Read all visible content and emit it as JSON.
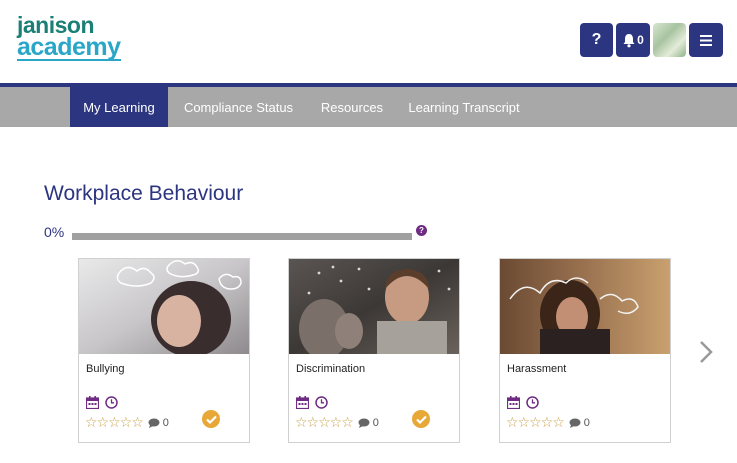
{
  "header": {
    "logo_line1": "janison",
    "logo_line2": "academy",
    "help_label": "?",
    "notification_count": "0"
  },
  "nav": {
    "items": [
      {
        "label": "My Learning",
        "active": true
      },
      {
        "label": "Compliance Status",
        "active": false
      },
      {
        "label": "Resources",
        "active": false
      },
      {
        "label": "Learning Transcript",
        "active": false
      }
    ]
  },
  "main": {
    "title": "Workplace Behaviour",
    "progress_label": "0%",
    "progress_value": 0,
    "progress_help": "?",
    "cards": [
      {
        "title": "Bullying",
        "stars": "☆☆☆☆☆",
        "comments": "0",
        "completed": true
      },
      {
        "title": "Discrimination",
        "stars": "☆☆☆☆☆",
        "comments": "0",
        "completed": true
      },
      {
        "title": "Harassment",
        "stars": "☆☆☆☆☆",
        "comments": "0",
        "completed": false
      }
    ]
  },
  "colors": {
    "brand_navy": "#2c3580",
    "nav_gray": "#a8a8a8",
    "logo_teal": "#1c7f76",
    "logo_blue": "#2aa6c8",
    "accent_purple": "#6e2c83",
    "star_gold": "#c8a04a",
    "complete_orange": "#e8a838"
  },
  "icons": [
    "help-icon",
    "bell-icon",
    "avatar",
    "hamburger-menu-icon",
    "calendar-icon",
    "clock-icon",
    "star-icon",
    "comment-icon",
    "check-circle-icon",
    "chevron-right-icon"
  ]
}
